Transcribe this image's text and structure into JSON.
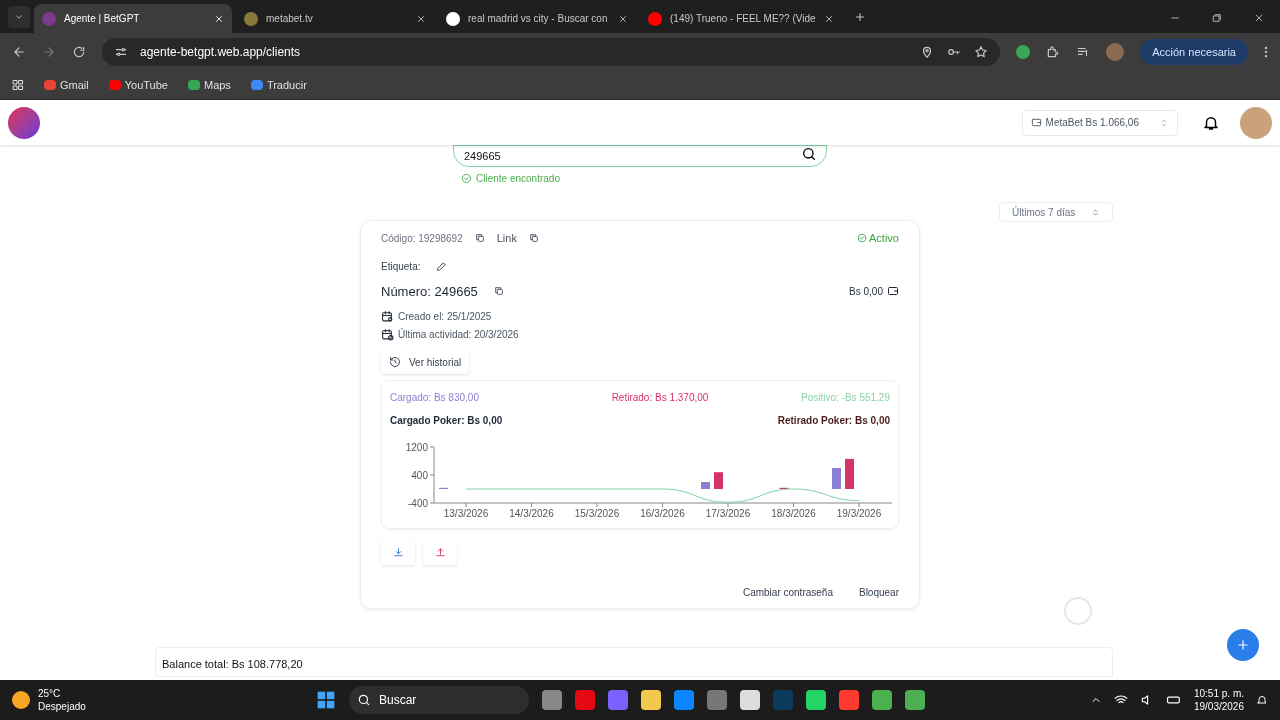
{
  "browser": {
    "tabs": [
      {
        "title": "Agente | BetGPT",
        "selected": true
      },
      {
        "title": "metabet.tv",
        "selected": false
      },
      {
        "title": "real madrid vs city - Buscar con",
        "selected": false
      },
      {
        "title": "(149) Trueno - FEEL ME?? (Vide",
        "selected": false
      }
    ],
    "url": "agente-betgpt.web.app/clients",
    "profile_button": "Acción necesaria",
    "bookmarks": [
      "Gmail",
      "YouTube",
      "Maps",
      "Traducir"
    ]
  },
  "header": {
    "wallet": "MetaBet Bs 1.066,06"
  },
  "search": {
    "value": "249665",
    "status": "Cliente encontrado"
  },
  "period": "Últimos 7 días",
  "client": {
    "code": "Código: 19298692",
    "link": "Link",
    "status": "Activo",
    "label": "Etiqueta:",
    "number": "Número: 249665",
    "balance": "Bs 0,00",
    "created": "Creado el: 25/1/2025",
    "last_activity": "Última actividad: 20/3/2026",
    "history_button": "Ver historial",
    "summary": [
      {
        "text": ": Bs 830,00"
      },
      {
        "text": ": Bs 1.370,00"
      },
      {
        "text": ": -Bs 551,29"
      },
      {
        "text": "Cargado Poker: Bs 0,00",
        "color": "#1f2937"
      },
      {
        "text": "Retirado Poker: Bs 0,00",
        "color": "#4a1d1d"
      }
    ],
    "chart_data": {
      "type": "bar",
      "categories": [
        "13/3/2026",
        "14/3/2026",
        "15/3/2026",
        "16/3/2026",
        "17/3/2026",
        "18/3/2026",
        "19/3/2026"
      ],
      "ylim": [
        -400,
        1200
      ],
      "yticks": [
        1200,
        400,
        -400
      ],
      "stacked": false,
      "series": [
        {
          "name": "Cargado",
          "color": "#8b80d4",
          "values": [
            10,
            0,
            0,
            0,
            200,
            0,
            600
          ]
        },
        {
          "name": "Retirado",
          "color": "#d6336c",
          "values": [
            0,
            0,
            0,
            0,
            480,
            30,
            860
          ]
        },
        {
          "name": "Positivo",
          "color": "#86d2a4",
          "type": "line",
          "values": [
            0,
            0,
            0,
            0,
            -380,
            0,
            -330
          ]
        }
      ]
    },
    "actions": [
      "Cambiar contraseña",
      "Bloquear"
    ]
  },
  "total_balance": "Balance total: Bs 108.778,20",
  "taskbar": {
    "weather_temp": "25°C",
    "weather_text": "Despejado",
    "search": "Buscar",
    "time": "10:51 p. m.",
    "date": "19/03/2026"
  }
}
